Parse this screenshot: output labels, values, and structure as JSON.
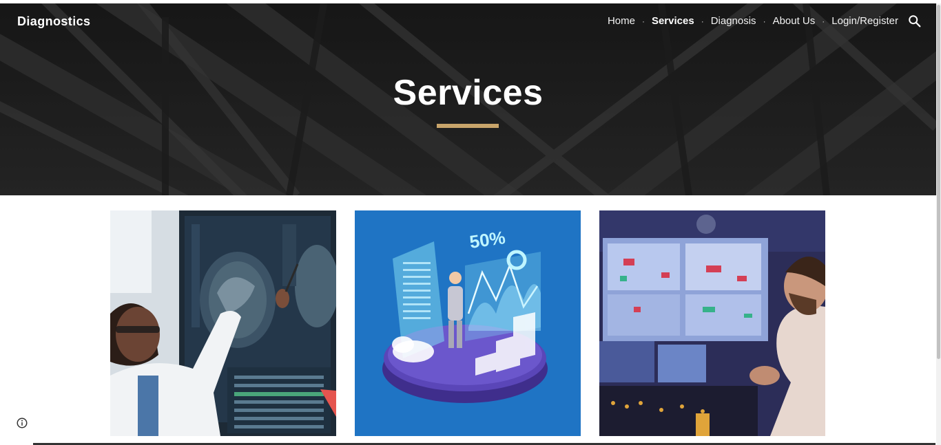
{
  "header": {
    "site_title": "Diagnostics",
    "nav": [
      {
        "label": "Home",
        "active": false
      },
      {
        "label": "Services",
        "active": true
      },
      {
        "label": "Diagnosis",
        "active": false
      },
      {
        "label": "About Us",
        "active": false
      },
      {
        "label": "Login/Register",
        "active": false
      }
    ],
    "separator": "·",
    "search_icon": "search-icon"
  },
  "hero": {
    "title": "Services",
    "accent_color": "#c8a46a"
  },
  "cards": [
    {
      "icon": "doctor-mri-scan-image"
    },
    {
      "icon": "isometric-data-analytics-image",
      "overlay_text": "50%"
    },
    {
      "icon": "monitoring-screens-image"
    }
  ],
  "footer": {
    "info_icon": "info-icon"
  }
}
